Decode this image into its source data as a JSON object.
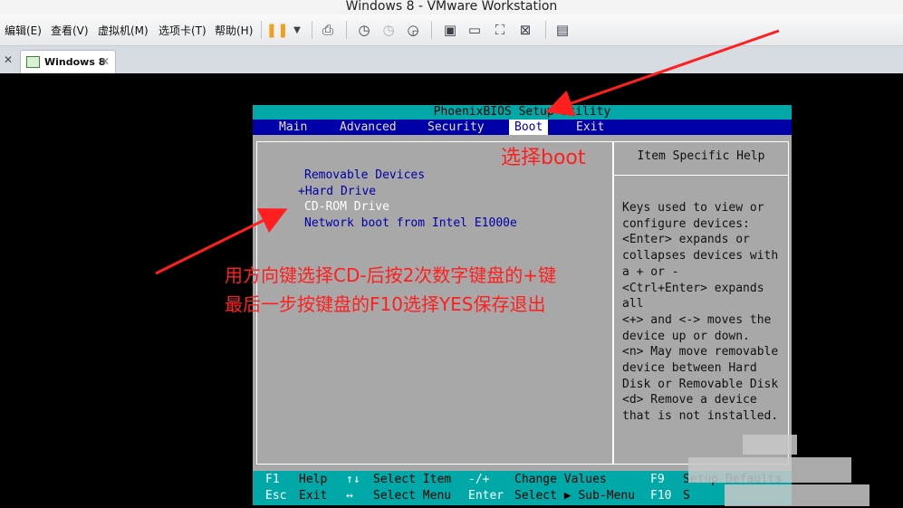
{
  "window": {
    "title": "Windows 8 - VMware Workstation"
  },
  "menu": {
    "items": [
      "编辑(E)",
      "查看(V)",
      "虚拟机(M)",
      "选项卡(T)",
      "帮助(H)"
    ]
  },
  "toolbar": {
    "icons": [
      "pause-icon",
      "dropdown-icon",
      "send-ctrl-alt-del-icon",
      "snapshot-icon",
      "revert-snapshot-icon",
      "snapshot-manager-icon",
      "console-view-icon",
      "fullscreen-icon",
      "unity-icon",
      "stretch-icon",
      "library-icon"
    ]
  },
  "tabs": {
    "active_label": "Windows 8"
  },
  "bios": {
    "title": "PhoenixBIOS Setup Utility",
    "menu": [
      "Main",
      "Advanced",
      "Security",
      "Boot",
      "Exit"
    ],
    "active_menu": "Boot",
    "boot_items": [
      "Removable Devices",
      "+Hard Drive",
      "CD-ROM Drive",
      "Network boot from Intel E1000e"
    ],
    "selected_item": "CD-ROM Drive",
    "help_title": "Item Specific Help",
    "help_text": "Keys used to view or\nconfigure devices:\n<Enter> expands or\ncollapses devices with\na + or -\n<Ctrl+Enter> expands\nall\n<+> and <-> moves the\ndevice up or down.\n<n> May move removable\ndevice between Hard\nDisk or Removable Disk\n<d> Remove a device\nthat is not installed.",
    "footer": {
      "row1": [
        {
          "key": "F1",
          "desc": "Help"
        },
        {
          "key": "↑↓",
          "desc": "Select Item"
        },
        {
          "key": "-/+",
          "desc": "Change Values"
        },
        {
          "key": "F9",
          "desc": "Setup Defaults"
        }
      ],
      "row2": [
        {
          "key": "Esc",
          "desc": "Exit"
        },
        {
          "key": "↔",
          "desc": "Select Menu"
        },
        {
          "key": "Enter",
          "desc": "Select ▶ Sub-Menu"
        },
        {
          "key": "F10",
          "desc": "S"
        }
      ]
    }
  },
  "annotations": {
    "select_boot": "选择boot",
    "line1": "用方向键选择CD-后按2次数字键盘的+键",
    "line2": "最后一步按键盘的F10选择YES保存退出",
    "color": "#ff1f1f"
  }
}
